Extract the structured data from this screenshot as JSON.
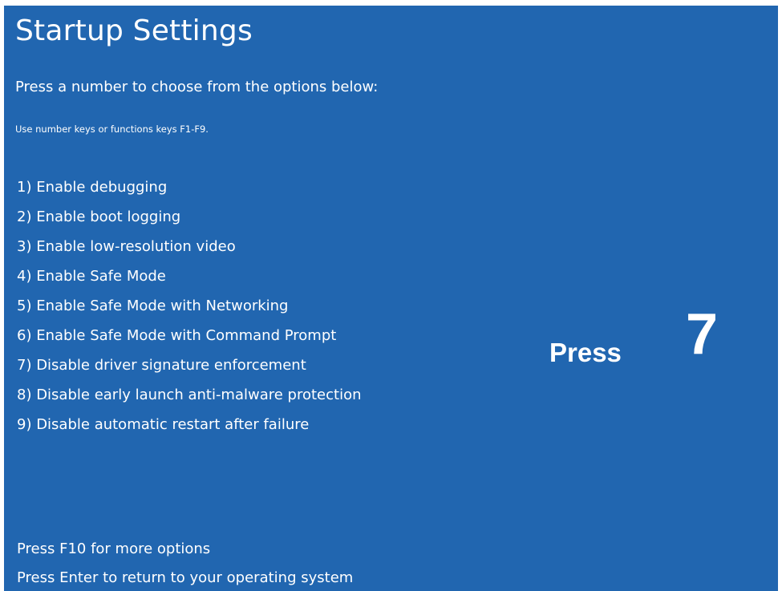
{
  "screen": {
    "title": "Startup Settings",
    "subtitle": "Press a number to choose from the options below:",
    "hint": "Use number keys or functions keys F1-F9.",
    "background_color": "#2166b0",
    "text_color": "#ffffff"
  },
  "options": [
    {
      "label": "1) Enable debugging"
    },
    {
      "label": "2) Enable boot logging"
    },
    {
      "label": "3) Enable low-resolution video"
    },
    {
      "label": "4) Enable Safe Mode"
    },
    {
      "label": "5) Enable Safe Mode with Networking"
    },
    {
      "label": "6) Enable Safe Mode with Command Prompt"
    },
    {
      "label": "7) Disable driver signature enforcement"
    },
    {
      "label": "8) Disable early launch anti-malware protection"
    },
    {
      "label": "9) Disable automatic restart after failure"
    }
  ],
  "annotation": {
    "press_label": "Press",
    "press_key": "7"
  },
  "footer": {
    "more_options": "Press F10 for more options",
    "return": "Press Enter to return to your operating system"
  }
}
